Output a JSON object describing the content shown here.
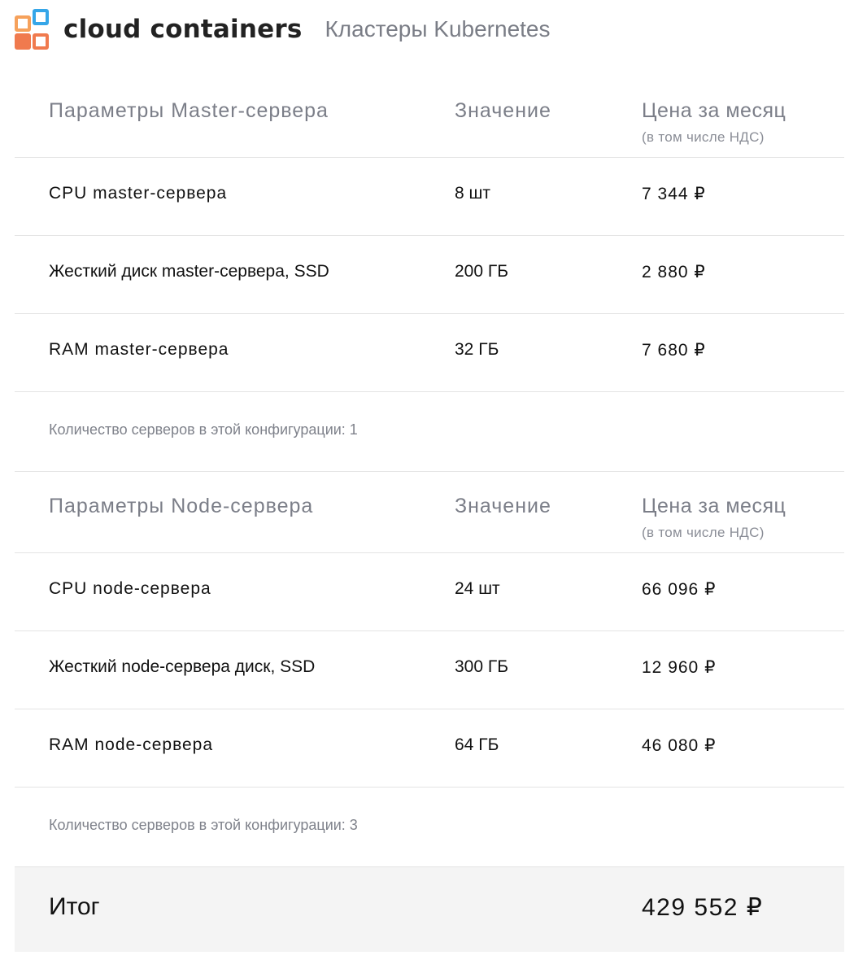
{
  "header": {
    "brand": "cloud containers",
    "section": "Кластеры Kubernetes"
  },
  "colors": {
    "logo_orange": "#f07a4e",
    "logo_light_orange": "#f6a15b",
    "logo_blue": "#35a6e8",
    "total_background": "#f4f4f4"
  },
  "master": {
    "header": {
      "param": "Параметры  Master-сервера",
      "value": "Значение",
      "price": "Цена за месяц",
      "price_note": "(в том числе НДС)"
    },
    "rows": [
      {
        "param": "CPU  master-сервера",
        "value": "8 шт",
        "price": "7 344 ₽"
      },
      {
        "param": "Жесткий диск master-сервера, SSD",
        "value": "200 ГБ",
        "price": "2 880 ₽"
      },
      {
        "param": "RAM  master-сервера",
        "value": "32 ГБ",
        "price": "7 680 ₽"
      }
    ],
    "count": "Количество серверов в этой конфигурации: 1"
  },
  "node": {
    "header": {
      "param": "Параметры  Node-сервера",
      "value": "Значение",
      "price": "Цена за месяц",
      "price_note": "(в том числе НДС)"
    },
    "rows": [
      {
        "param": "CPU  node-сервера",
        "value": "24 шт",
        "price": "66 096 ₽"
      },
      {
        "param": "Жесткий node-сервера диск, SSD",
        "value": "300 ГБ",
        "price": "12 960 ₽"
      },
      {
        "param": "RAM  node-сервера",
        "value": "64 ГБ",
        "price": "46 080 ₽"
      }
    ],
    "count": "Количество серверов в этой конфигурации: 3"
  },
  "total": {
    "label": "Итог",
    "value": "429  552   ₽"
  }
}
